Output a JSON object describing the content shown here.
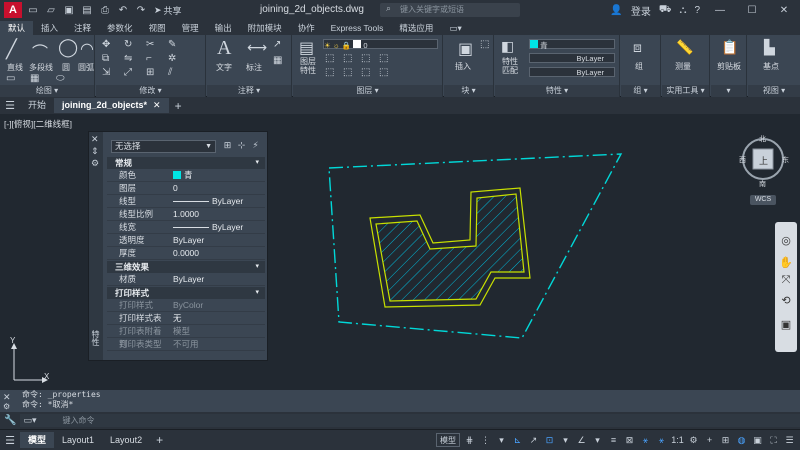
{
  "titlebar": {
    "logo": "A",
    "share_label": "共享",
    "title": "joining_2d_objects.dwg",
    "search_placeholder": "键入关键字或短语",
    "login_label": "登录"
  },
  "ribbon_tabs": [
    "默认",
    "插入",
    "注释",
    "参数化",
    "视图",
    "管理",
    "输出",
    "附加模块",
    "协作",
    "Express Tools",
    "精选应用"
  ],
  "ribbon": {
    "draw": {
      "title": "绘图",
      "line": "直线",
      "polyline": "多段线",
      "circle": "圆",
      "arc": "圆弧"
    },
    "modify": {
      "title": "修改"
    },
    "annotation": {
      "title": "注释",
      "text": "文字",
      "dim": "标注"
    },
    "layers": {
      "title": "图层",
      "layer_props": "图层\n特性",
      "layer_value": "0"
    },
    "block": {
      "title": "块",
      "insert": "插入"
    },
    "properties": {
      "title": "特性",
      "match": "特性\n匹配",
      "color": "青",
      "linetype1": "ByLayer",
      "linetype2": "ByLayer",
      "linetype3": "ByLayer"
    },
    "groups": {
      "title": "组",
      "group": "组"
    },
    "utilities": {
      "title": "实用工具",
      "measure": "测量"
    },
    "clipboard": {
      "title": "",
      "paste": "剪贴板"
    },
    "view": {
      "title": "视图",
      "base": "基点"
    }
  },
  "doc_tabs": {
    "start": "开始",
    "active": "joining_2d_objects*"
  },
  "viewport_label": "[-][俯视][二维线框]",
  "properties_palette": {
    "selection": "无选择",
    "side_label": "特性",
    "sections": [
      {
        "title": "常规",
        "rows": [
          {
            "key": "颜色",
            "value": "青",
            "swatch": "#00e5e5"
          },
          {
            "key": "图层",
            "value": "0"
          },
          {
            "key": "线型",
            "value": "ByLayer",
            "line": true
          },
          {
            "key": "线型比例",
            "value": "1.0000"
          },
          {
            "key": "线宽",
            "value": "ByLayer",
            "line": true
          },
          {
            "key": "透明度",
            "value": "ByLayer"
          },
          {
            "key": "厚度",
            "value": "0.0000"
          }
        ]
      },
      {
        "title": "三维效果",
        "rows": [
          {
            "key": "材质",
            "value": "ByLayer"
          }
        ]
      },
      {
        "title": "打印样式",
        "rows": [
          {
            "key": "打印样式",
            "value": "ByColor",
            "disabled": true
          },
          {
            "key": "打印样式表",
            "value": "无"
          },
          {
            "key": "打印表附着到",
            "value": "模型",
            "disabled": true
          },
          {
            "key": "打印表类型",
            "value": "不可用",
            "disabled": true
          }
        ]
      }
    ]
  },
  "viewcube": {
    "north": "北",
    "south": "南",
    "east": "东",
    "west": "西",
    "face": "上",
    "wcs": "WCS"
  },
  "ucs": {
    "x": "X",
    "y": "Y"
  },
  "command": {
    "history": [
      "命令: _properties",
      "命令: *取消*"
    ],
    "placeholder": "键入命令"
  },
  "status_tabs": [
    "模型",
    "Layout1",
    "Layout2"
  ],
  "status_right": {
    "model": "模型",
    "scale": "1:1"
  },
  "colors": {
    "cyan": "#00d8d8",
    "yellow_green": "#c8e000",
    "bg": "#212830",
    "ribbon": "#3b4653"
  }
}
